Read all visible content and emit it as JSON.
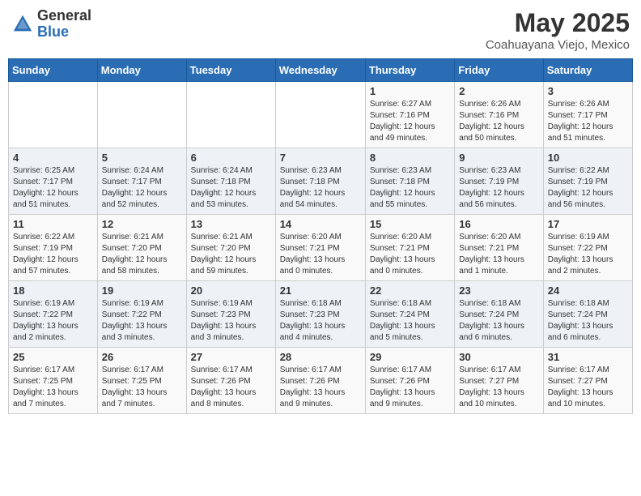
{
  "header": {
    "logo_general": "General",
    "logo_blue": "Blue",
    "title": "May 2025",
    "location": "Coahuayana Viejo, Mexico"
  },
  "days_of_week": [
    "Sunday",
    "Monday",
    "Tuesday",
    "Wednesday",
    "Thursday",
    "Friday",
    "Saturday"
  ],
  "weeks": [
    [
      {
        "day": "",
        "info": ""
      },
      {
        "day": "",
        "info": ""
      },
      {
        "day": "",
        "info": ""
      },
      {
        "day": "",
        "info": ""
      },
      {
        "day": "1",
        "info": "Sunrise: 6:27 AM\nSunset: 7:16 PM\nDaylight: 12 hours\nand 49 minutes."
      },
      {
        "day": "2",
        "info": "Sunrise: 6:26 AM\nSunset: 7:16 PM\nDaylight: 12 hours\nand 50 minutes."
      },
      {
        "day": "3",
        "info": "Sunrise: 6:26 AM\nSunset: 7:17 PM\nDaylight: 12 hours\nand 51 minutes."
      }
    ],
    [
      {
        "day": "4",
        "info": "Sunrise: 6:25 AM\nSunset: 7:17 PM\nDaylight: 12 hours\nand 51 minutes."
      },
      {
        "day": "5",
        "info": "Sunrise: 6:24 AM\nSunset: 7:17 PM\nDaylight: 12 hours\nand 52 minutes."
      },
      {
        "day": "6",
        "info": "Sunrise: 6:24 AM\nSunset: 7:18 PM\nDaylight: 12 hours\nand 53 minutes."
      },
      {
        "day": "7",
        "info": "Sunrise: 6:23 AM\nSunset: 7:18 PM\nDaylight: 12 hours\nand 54 minutes."
      },
      {
        "day": "8",
        "info": "Sunrise: 6:23 AM\nSunset: 7:18 PM\nDaylight: 12 hours\nand 55 minutes."
      },
      {
        "day": "9",
        "info": "Sunrise: 6:23 AM\nSunset: 7:19 PM\nDaylight: 12 hours\nand 56 minutes."
      },
      {
        "day": "10",
        "info": "Sunrise: 6:22 AM\nSunset: 7:19 PM\nDaylight: 12 hours\nand 56 minutes."
      }
    ],
    [
      {
        "day": "11",
        "info": "Sunrise: 6:22 AM\nSunset: 7:19 PM\nDaylight: 12 hours\nand 57 minutes."
      },
      {
        "day": "12",
        "info": "Sunrise: 6:21 AM\nSunset: 7:20 PM\nDaylight: 12 hours\nand 58 minutes."
      },
      {
        "day": "13",
        "info": "Sunrise: 6:21 AM\nSunset: 7:20 PM\nDaylight: 12 hours\nand 59 minutes."
      },
      {
        "day": "14",
        "info": "Sunrise: 6:20 AM\nSunset: 7:21 PM\nDaylight: 13 hours\nand 0 minutes."
      },
      {
        "day": "15",
        "info": "Sunrise: 6:20 AM\nSunset: 7:21 PM\nDaylight: 13 hours\nand 0 minutes."
      },
      {
        "day": "16",
        "info": "Sunrise: 6:20 AM\nSunset: 7:21 PM\nDaylight: 13 hours\nand 1 minute."
      },
      {
        "day": "17",
        "info": "Sunrise: 6:19 AM\nSunset: 7:22 PM\nDaylight: 13 hours\nand 2 minutes."
      }
    ],
    [
      {
        "day": "18",
        "info": "Sunrise: 6:19 AM\nSunset: 7:22 PM\nDaylight: 13 hours\nand 2 minutes."
      },
      {
        "day": "19",
        "info": "Sunrise: 6:19 AM\nSunset: 7:22 PM\nDaylight: 13 hours\nand 3 minutes."
      },
      {
        "day": "20",
        "info": "Sunrise: 6:19 AM\nSunset: 7:23 PM\nDaylight: 13 hours\nand 3 minutes."
      },
      {
        "day": "21",
        "info": "Sunrise: 6:18 AM\nSunset: 7:23 PM\nDaylight: 13 hours\nand 4 minutes."
      },
      {
        "day": "22",
        "info": "Sunrise: 6:18 AM\nSunset: 7:24 PM\nDaylight: 13 hours\nand 5 minutes."
      },
      {
        "day": "23",
        "info": "Sunrise: 6:18 AM\nSunset: 7:24 PM\nDaylight: 13 hours\nand 6 minutes."
      },
      {
        "day": "24",
        "info": "Sunrise: 6:18 AM\nSunset: 7:24 PM\nDaylight: 13 hours\nand 6 minutes."
      }
    ],
    [
      {
        "day": "25",
        "info": "Sunrise: 6:17 AM\nSunset: 7:25 PM\nDaylight: 13 hours\nand 7 minutes."
      },
      {
        "day": "26",
        "info": "Sunrise: 6:17 AM\nSunset: 7:25 PM\nDaylight: 13 hours\nand 7 minutes."
      },
      {
        "day": "27",
        "info": "Sunrise: 6:17 AM\nSunset: 7:26 PM\nDaylight: 13 hours\nand 8 minutes."
      },
      {
        "day": "28",
        "info": "Sunrise: 6:17 AM\nSunset: 7:26 PM\nDaylight: 13 hours\nand 9 minutes."
      },
      {
        "day": "29",
        "info": "Sunrise: 6:17 AM\nSunset: 7:26 PM\nDaylight: 13 hours\nand 9 minutes."
      },
      {
        "day": "30",
        "info": "Sunrise: 6:17 AM\nSunset: 7:27 PM\nDaylight: 13 hours\nand 10 minutes."
      },
      {
        "day": "31",
        "info": "Sunrise: 6:17 AM\nSunset: 7:27 PM\nDaylight: 13 hours\nand 10 minutes."
      }
    ]
  ]
}
